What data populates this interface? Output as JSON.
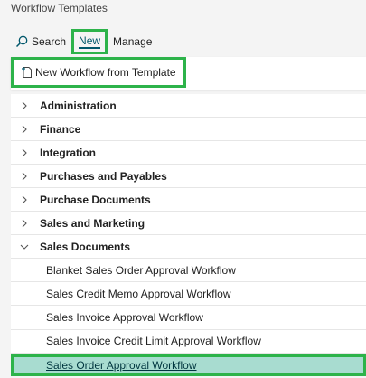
{
  "page": {
    "title": "Workflow Templates"
  },
  "action_bar": {
    "search_label": "Search",
    "new_label": "New",
    "manage_label": "Manage"
  },
  "new_panel": {
    "template_button_label": "New Workflow from Template"
  },
  "tree": {
    "groups": [
      {
        "label": "Administration",
        "expanded": false
      },
      {
        "label": "Finance",
        "expanded": false
      },
      {
        "label": "Integration",
        "expanded": false
      },
      {
        "label": "Purchases and Payables",
        "expanded": false
      },
      {
        "label": "Purchase Documents",
        "expanded": false
      },
      {
        "label": "Sales and Marketing",
        "expanded": false
      },
      {
        "label": "Sales Documents",
        "expanded": true
      }
    ],
    "children": [
      {
        "label": "Blanket Sales Order Approval Workflow"
      },
      {
        "label": "Sales Credit Memo Approval Workflow"
      },
      {
        "label": "Sales Invoice Approval Workflow"
      },
      {
        "label": "Sales Invoice Credit Limit Approval Workflow"
      },
      {
        "label": "Sales Order Approval Workflow"
      }
    ]
  },
  "colors": {
    "highlight_border": "#2db34a",
    "selected_row": "#a8dcd0",
    "link": "#00576b"
  }
}
